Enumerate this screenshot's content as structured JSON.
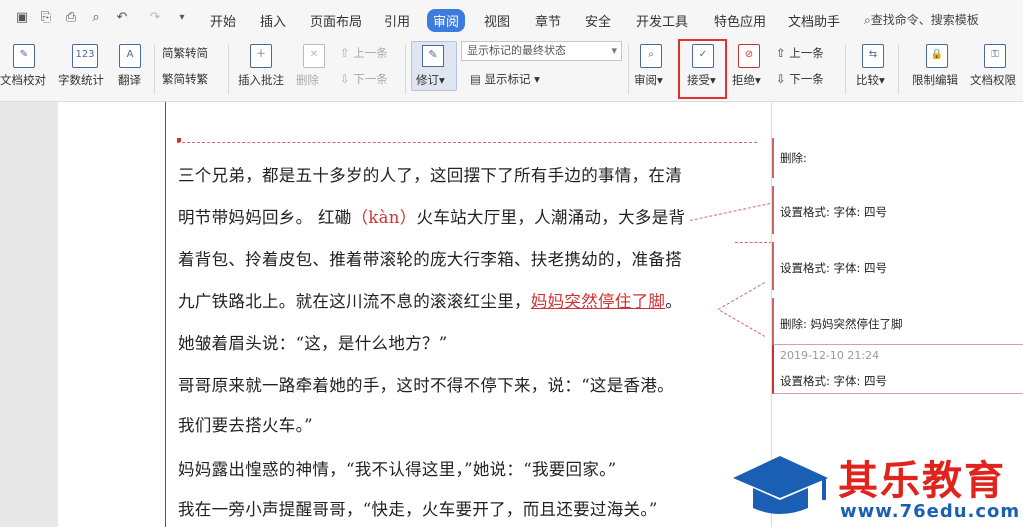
{
  "menubar": {
    "tabs": [
      "开始",
      "插入",
      "页面布局",
      "引用",
      "审阅",
      "视图",
      "章节",
      "安全",
      "开发工具",
      "特色应用",
      "文档助手"
    ],
    "active_tab": "审阅",
    "search": "查找命令、搜索模板"
  },
  "ribbon": {
    "proofread": "文档校对",
    "wordcount": "字数统计",
    "translate": "翻译",
    "trad": "繁转简",
    "simp": "简转繁",
    "insert_comment": "插入批注",
    "delete": "删除",
    "prev_comment": "上一条",
    "next_comment": "下一条",
    "revise": "修订",
    "status_select": "显示标记的最终状态",
    "show_markup": "显示标记",
    "review": "审阅",
    "accept": "接受",
    "reject": "拒绝",
    "prev_change": "上一条",
    "next_change": "下一条",
    "compare": "比较",
    "restrict": "限制编辑",
    "permission": "文档权限"
  },
  "document": {
    "lines": [
      "三个兄弟，都是五十多岁的人了，这回摆下了所有手边的事情，在清",
      "明节带妈妈回乡。 红磡",
      "（kàn）",
      "火车站大厅里，人潮涌动，大多是背",
      "着背包、拎着皮包、推着带滚轮的庞大行李箱、扶老携幼的，准备搭",
      "九广铁路北上。就在这川流不息的滚滚红尘里，",
      "妈妈突然停住了脚",
      "。",
      "她皱着眉头说：“这，是什么地方？”",
      "哥哥原来就一路牵着她的手，这时不得不停下来，说：“这是香港。",
      "我们要去搭火车。”",
      "妈妈露出惶惑的神情，“我不认得这里，”她说：“我要回家。”",
      "我在一旁小声提醒哥哥，“快走，火车要开了，而且还要过海关。”"
    ]
  },
  "balloons": [
    {
      "text": "删除:"
    },
    {
      "text": "设置格式: 字体: 四号"
    },
    {
      "text": "设置格式: 字体: 四号"
    },
    {
      "text": "删除: 妈妈突然停住了脚"
    },
    {
      "text": "设置格式: 字体: 四号",
      "timestamp": "2019-12-10 21:24"
    }
  ],
  "watermark": {
    "name": "其乐教育",
    "url": "www.76edu.com"
  },
  "colors": {
    "accent": "#3d7be0",
    "revision": "#cc3333",
    "highlight_box": "#e03030"
  }
}
